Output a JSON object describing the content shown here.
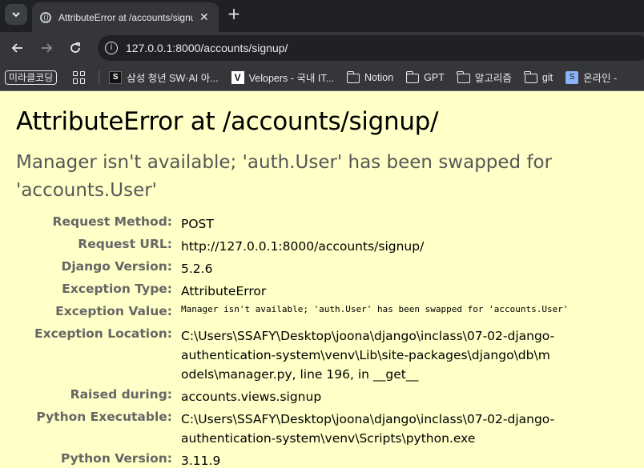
{
  "browser": {
    "tab_title": "AttributeError at /accounts/signup/",
    "url": "127.0.0.1:8000/accounts/signup/",
    "bookmarks": [
      {
        "label": "미라클코딩",
        "icon": "badge"
      },
      {
        "label": "삼성 청년 SW·AI 아...",
        "icon": "dark-s-icon"
      },
      {
        "label": "Velopers - 국내 IT...",
        "icon": "v-icon"
      },
      {
        "label": "Notion",
        "icon": "folder-icon"
      },
      {
        "label": "GPT",
        "icon": "folder-icon"
      },
      {
        "label": "알고리즘",
        "icon": "folder-icon"
      },
      {
        "label": "git",
        "icon": "folder-icon"
      },
      {
        "label": "온라인 -",
        "icon": "doc-icon"
      }
    ]
  },
  "error": {
    "title": "AttributeError at /accounts/signup/",
    "message": "Manager isn't available; 'auth.User' has been swapped for 'accounts.User'"
  },
  "meta": [
    {
      "label": "Request Method:",
      "value": "POST"
    },
    {
      "label": "Request URL:",
      "value": "http://127.0.0.1:8000/accounts/signup/"
    },
    {
      "label": "Django Version:",
      "value": "5.2.6"
    },
    {
      "label": "Exception Type:",
      "value": "AttributeError"
    },
    {
      "label": "Exception Value:",
      "value": "Manager isn't available; 'auth.User' has been swapped for 'accounts.User'"
    },
    {
      "label": "Exception Location:",
      "value": "C:\\Users\\SSAFY\\Desktop\\joona\\django\\inclass\\07-02-django-authentication-system\\venv\\Lib\\site-packages\\django\\db\\models\\manager.py, line 196, in __get__"
    },
    {
      "label": "Raised during:",
      "value": "accounts.views.signup"
    },
    {
      "label": "Python Executable:",
      "value": "C:\\Users\\SSAFY\\Desktop\\joona\\django\\inclass\\07-02-django-authentication-system\\venv\\Scripts\\python.exe"
    },
    {
      "label": "Python Version:",
      "value": "3.11.9"
    }
  ]
}
